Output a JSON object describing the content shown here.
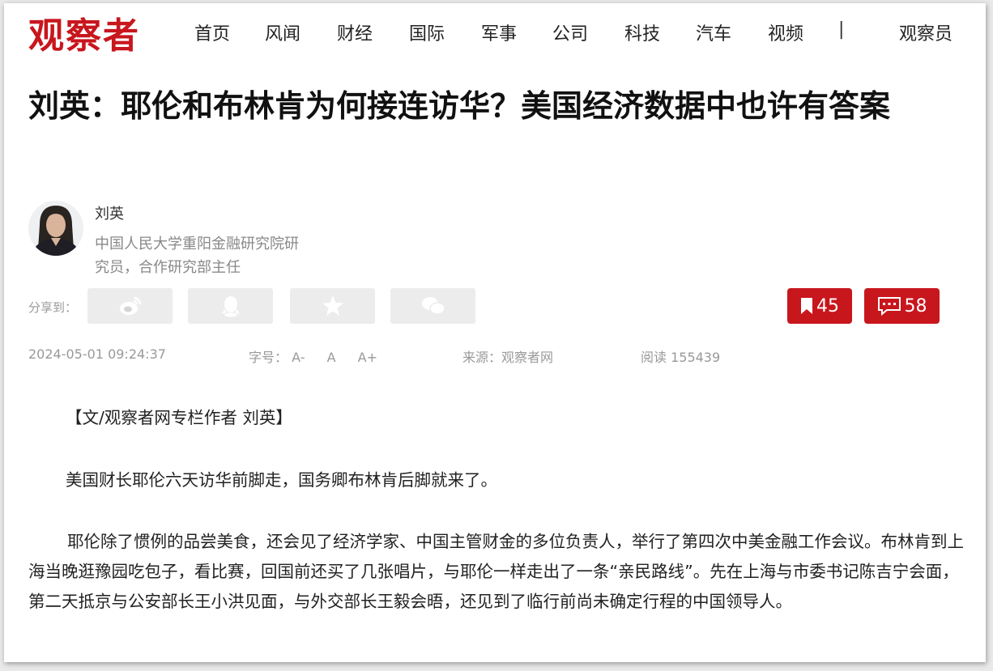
{
  "header": {
    "logo": "观察者",
    "nav": [
      "首页",
      "风闻",
      "财经",
      "国际",
      "军事",
      "公司",
      "科技",
      "汽车",
      "视频"
    ],
    "separator": "|",
    "right_link": "观察员"
  },
  "article": {
    "title": "刘英：耶伦和布林肯为何接连访华？美国经济数据中也许有答案",
    "author": {
      "name": "刘英",
      "bio": "中国人民大学重阳金融研究院研究员，合作研究部主任"
    },
    "share": {
      "label": "分享到：",
      "buttons": [
        "weibo-icon",
        "qq-icon",
        "qzone-icon",
        "wechat-icon"
      ]
    },
    "bookmark_count": "45",
    "comment_count": "58",
    "meta": {
      "datetime": "2024-05-01 09:24:37",
      "font_size_label": "字号：",
      "font_small": "A-",
      "font_normal": "A",
      "font_large": "A+",
      "source": "来源：观察者网",
      "reads": "阅读 155439"
    },
    "paragraphs": [
      "【文/观察者网专栏作者 刘英】",
      "美国财长耶伦六天访华前脚走，国务卿布林肯后脚就来了。",
      "耶伦除了惯例的品尝美食，还会见了经济学家、中国主管财金的多位负责人，举行了第四次中美金融工作会议。布林肯到上海当晚逛豫园吃包子，看比赛，回国前还买了几张唱片，与耶伦一样走出了一条“亲民路线”。先在上海与市委书记陈吉宁会面，第二天抵京与公安部长王小洪见面，与外交部长王毅会晤，还见到了临行前尚未确定行程的中国领导人。"
    ]
  },
  "colors": {
    "brand_red": "#c8161d"
  }
}
